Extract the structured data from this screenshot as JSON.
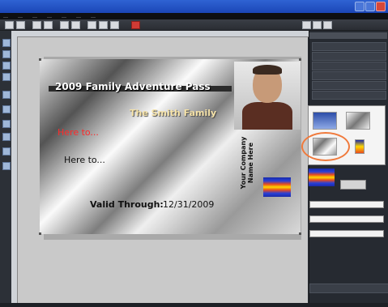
{
  "window": {
    "title": "",
    "minimize_label": "",
    "maximize_label": "",
    "close_label": ""
  },
  "menu": {
    "items": [
      "…",
      "…",
      "…",
      "…",
      "…",
      "…",
      "…"
    ]
  },
  "card": {
    "title": "2009 Family Adventure Pass",
    "family": "The Smith Family",
    "here_red": "Here to...",
    "here_black": "Here to...",
    "valid_label": "Valid Through:",
    "valid_date": "12/31/2009",
    "company": "Your Company Name Here"
  },
  "right_panel": {
    "header": "",
    "button_label": "",
    "fields": [
      "",
      "",
      "",
      ""
    ],
    "field_labels": [
      "",
      "",
      ""
    ]
  },
  "colors": {
    "accent": "#f07a3c",
    "here_red": "#ff2a2a",
    "family_gold": "#f5e2a8"
  },
  "icons": {
    "toolbar": [
      "new-icon",
      "open-icon",
      "save-icon",
      "print-icon",
      "cut-icon",
      "copy-icon",
      "paste-icon",
      "undo-icon",
      "redo-icon",
      "delete-icon"
    ]
  }
}
